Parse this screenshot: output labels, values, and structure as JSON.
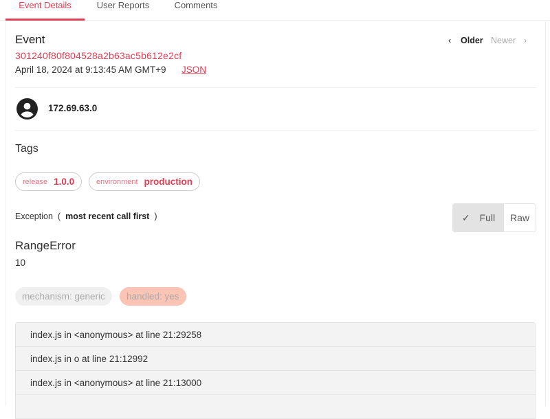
{
  "tabs": [
    "Event Details",
    "User Reports",
    "Comments"
  ],
  "event": {
    "title": "Event",
    "id": "301240f80f804528a2b63ac5b612e2cf",
    "date": "April 18, 2024 at 9:13:45 AM GMT+9",
    "json_link": "JSON",
    "older": "Older",
    "newer": "Newer"
  },
  "user": {
    "ip": "172.69.63.0"
  },
  "tags": {
    "title": "Tags",
    "items": [
      {
        "key": "release",
        "value": "1.0.0"
      },
      {
        "key": "environment",
        "value": "production"
      }
    ]
  },
  "exception": {
    "label": "Exception",
    "open": "(",
    "order": "most recent call first",
    "close": ")",
    "full": "Full",
    "raw": "Raw",
    "type": "RangeError",
    "value": "10",
    "mechanism": "mechanism: generic",
    "handled": "handled: yes"
  },
  "frames": [
    "index.js in <anonymous> at line 21:29258",
    "index.js in o at line 21:12992",
    "index.js in <anonymous> at line 21:13000"
  ],
  "colors": {
    "accent": "#e03e52",
    "handled_bg": "#fbc4b5"
  }
}
